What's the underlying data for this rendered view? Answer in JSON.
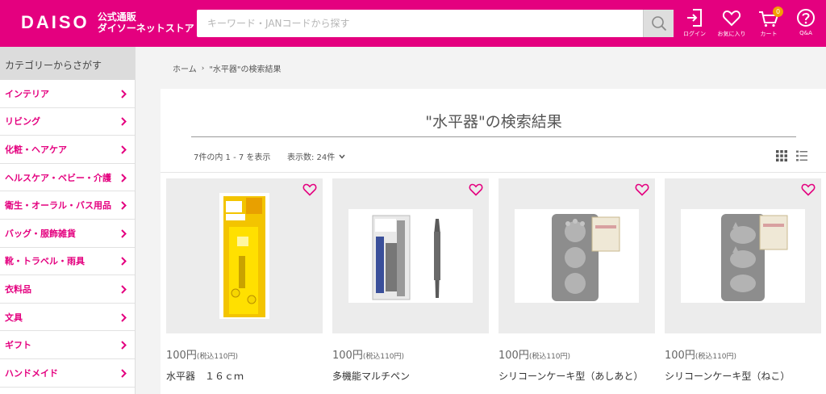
{
  "header": {
    "logo_text": "DAISO",
    "logo_sub1": "公式通販",
    "logo_sub2": "ダイソーネットストア",
    "search_placeholder": "キーワード・JANコードから探す",
    "search_value": "",
    "icons": {
      "login": "ログイン",
      "favorites": "お気に入り",
      "cart": "カート",
      "cart_count": "0",
      "qa": "Q&A"
    }
  },
  "sidebar": {
    "title": "カテゴリーからさがす",
    "categories": [
      "インテリア",
      "リビング",
      "化粧・ヘアケア",
      "ヘルスケア・ベビー・介護",
      "衛生・オーラル・バス用品",
      "バッグ・服飾雑貨",
      "靴・トラベル・雨具",
      "衣料品",
      "文具",
      "ギフト",
      "ハンドメイド"
    ]
  },
  "breadcrumb": {
    "home": "ホーム",
    "current": "\"水平器\"の検索結果"
  },
  "results": {
    "title": "\"水平器\"の検索結果",
    "count_text": "7件の内 1 - 7 を表示",
    "per_page": "表示数: 24件"
  },
  "products": [
    {
      "price": "100円",
      "price_tax": "(税込110円)",
      "name": "水平器　１６ｃｍ"
    },
    {
      "price": "100円",
      "price_tax": "(税込110円)",
      "name": "多機能マルチペン"
    },
    {
      "price": "100円",
      "price_tax": "(税込110円)",
      "name": "シリコーンケーキ型（あしあと）"
    },
    {
      "price": "100円",
      "price_tax": "(税込110円)",
      "name": "シリコーンケーキ型（ねこ）"
    }
  ],
  "colors": {
    "brand": "#e4007f",
    "sidebar_title_bg": "#dcdcdc"
  }
}
